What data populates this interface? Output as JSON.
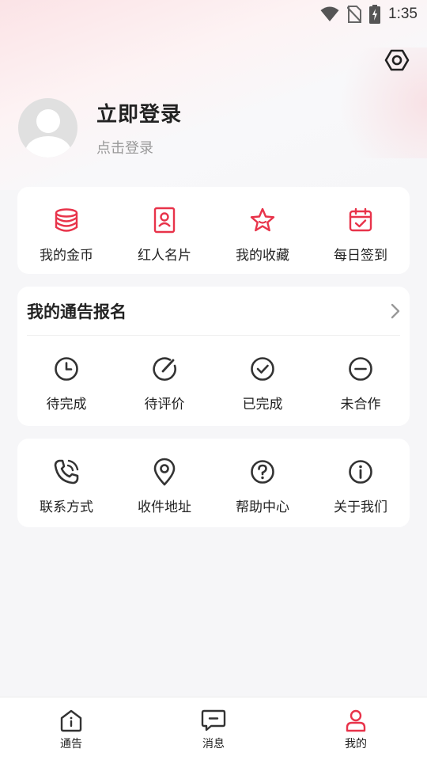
{
  "status": {
    "time": "1:35"
  },
  "profile": {
    "title": "立即登录",
    "subtitle": "点击登录"
  },
  "quick_actions": [
    {
      "label": "我的金币",
      "icon": "coins-icon"
    },
    {
      "label": "红人名片",
      "icon": "contact-card-icon"
    },
    {
      "label": "我的收藏",
      "icon": "star-icon"
    },
    {
      "label": "每日签到",
      "icon": "calendar-check-icon"
    }
  ],
  "notices": {
    "title": "我的通告报名",
    "items": [
      {
        "label": "待完成",
        "icon": "clock-icon"
      },
      {
        "label": "待评价",
        "icon": "edit-icon"
      },
      {
        "label": "已完成",
        "icon": "check-circle-icon"
      },
      {
        "label": "未合作",
        "icon": "minus-circle-icon"
      }
    ]
  },
  "services": [
    {
      "label": "联系方式",
      "icon": "phone-icon"
    },
    {
      "label": "收件地址",
      "icon": "location-icon"
    },
    {
      "label": "帮助中心",
      "icon": "help-icon"
    },
    {
      "label": "关于我们",
      "icon": "info-icon"
    }
  ],
  "tabs": [
    {
      "label": "通告",
      "icon": "home-icon"
    },
    {
      "label": "消息",
      "icon": "message-icon"
    },
    {
      "label": "我的",
      "icon": "person-icon",
      "active": true
    }
  ],
  "colors": {
    "accent": "#e8334a",
    "icon_dark": "#333333"
  }
}
